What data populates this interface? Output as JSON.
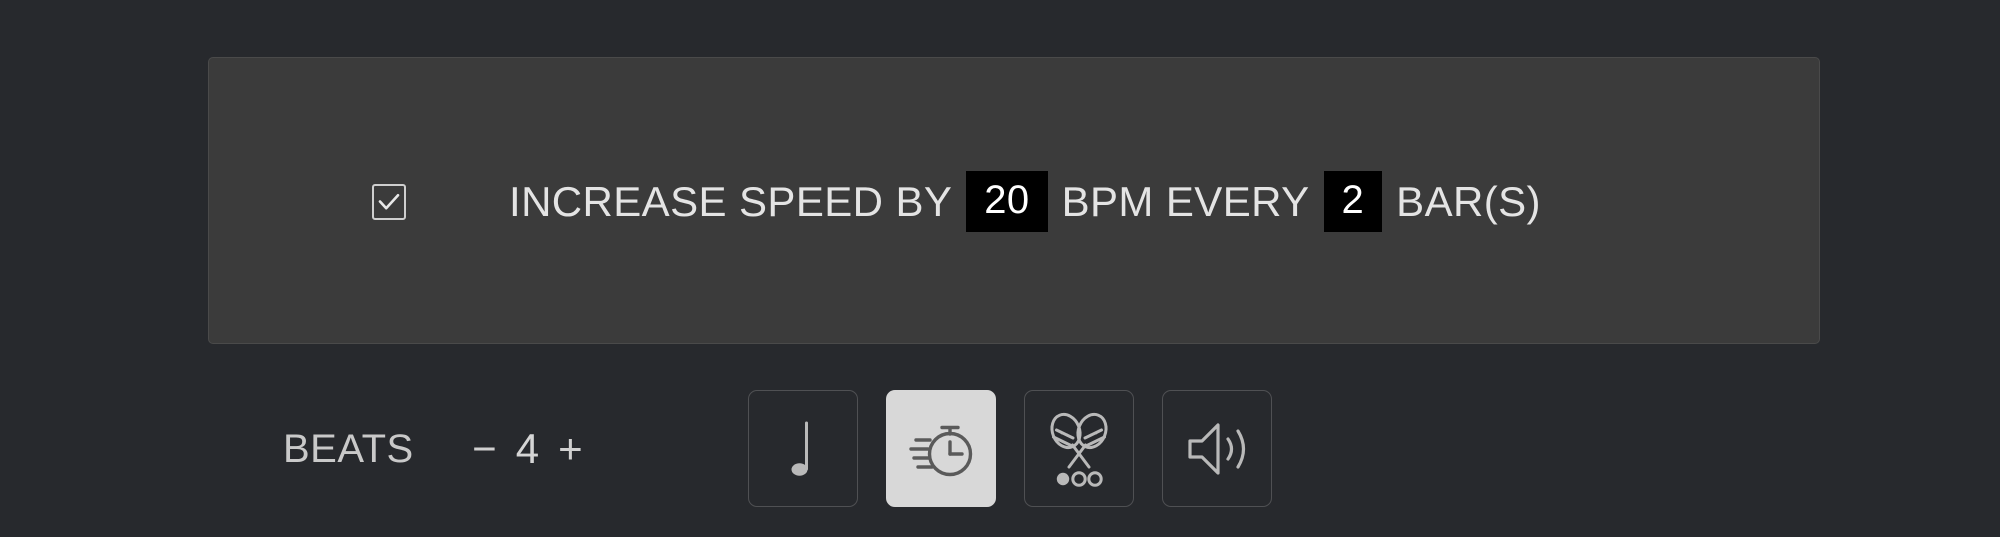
{
  "theme": {
    "page_bg": "#27292d",
    "panel_bg": "#3b3b3b",
    "panel_border": "#4a4a4a",
    "text": "#e4e4e4",
    "muted_text": "#c9c9c9",
    "badge_bg": "#000000",
    "badge_text": "#ffffff",
    "active_button_bg": "#d8d8d8",
    "icon_stroke": "#b9b9b9",
    "active_icon_stroke": "#5a5a5a"
  },
  "speed_trainer": {
    "enabled_checkbox": {
      "name": "increase-speed-checkbox",
      "checked": true,
      "icon": "checkmark-icon"
    },
    "sentence": {
      "prefix": "INCREASE SPEED BY",
      "bpm_amount": "20",
      "middle": "BPM EVERY",
      "bar_interval": "2",
      "suffix": "BAR(S)"
    }
  },
  "bottom_bar": {
    "beats": {
      "label": "BEATS",
      "decrement_label": "−",
      "value": "4",
      "increment_label": "+"
    },
    "mode_buttons": [
      {
        "name": "note-value-button",
        "icon": "quarter-note-icon",
        "active": false
      },
      {
        "name": "speed-trainer-button",
        "icon": "stopwatch-speed-icon",
        "active": true
      },
      {
        "name": "rhythm-button",
        "icon": "maracas-icon",
        "active": false
      },
      {
        "name": "sound-button",
        "icon": "speaker-volume-icon",
        "active": false
      }
    ]
  }
}
